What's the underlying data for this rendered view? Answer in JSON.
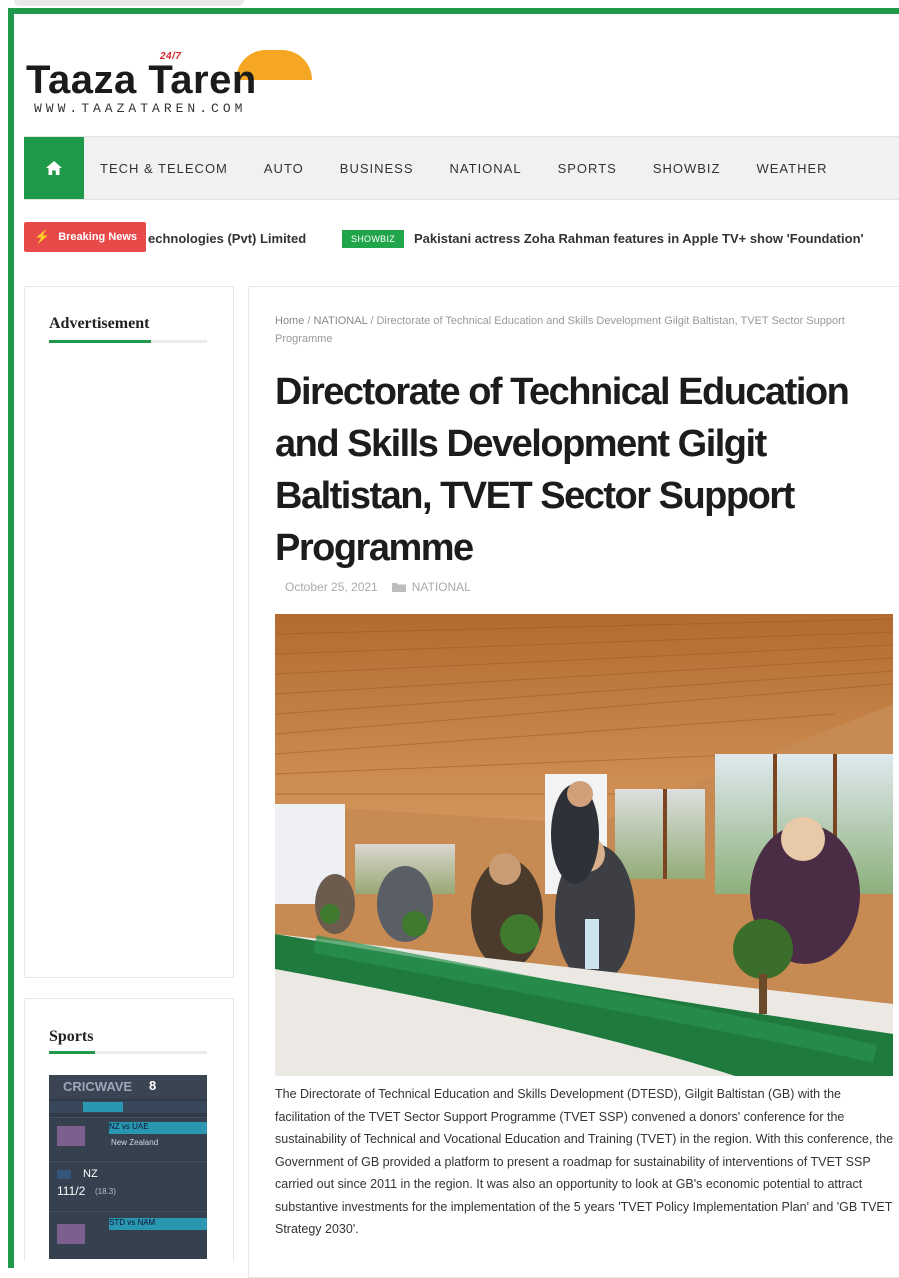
{
  "site": {
    "logo_text": "Taaza Taren",
    "logo_badge": "24/7",
    "logo_url": "WWW.TAAZATAREN.COM"
  },
  "nav": {
    "home_icon": "home-icon",
    "items": [
      "TECH & TELECOM",
      "AUTO",
      "BUSINESS",
      "NATIONAL",
      "SPORTS",
      "SHOWBIZ",
      "WEATHER"
    ]
  },
  "ticker": {
    "label": "Breaking News",
    "item1": "echnologies (Pvt) Limited",
    "badge": "SHOWBIZ",
    "item2": "Pakistani actress Zoha Rahman features in Apple TV+ show 'Foundation'"
  },
  "sidebar": {
    "ad_title": "Advertisement",
    "sports_title": "Sports",
    "sports_widget": {
      "logo": "CRICWAVE",
      "count": "8",
      "team_row": "NZ",
      "score": "111/2",
      "score_overs": "(18.3)",
      "band1": "NZ vs UAE",
      "band2": "New Zealand",
      "band3": "STD vs NAM"
    }
  },
  "article": {
    "breadcrumb_home": "Home",
    "breadcrumb_sep": " / ",
    "breadcrumb_cat": "NATIONAL",
    "breadcrumb_current": "Directorate of Technical Education and Skills Development Gilgit Baltistan, TVET Sector Support Programme",
    "title": "Directorate of Technical Education and Skills Development Gilgit Baltistan, TVET Sector Support Programme",
    "date": "October 25, 2021",
    "category": "NATIONAL",
    "body": "The Directorate of Technical Education and Skills Development (DTESD), Gilgit Baltistan (GB) with the facilitation of the TVET Sector Support Programme (TVET SSP) convened a donors' conference for the sustainability of Technical and Vocational Education and Training (TVET) in the region. With this conference, the Government of GB provided a platform to present a roadmap for sustainability of interventions of TVET SSP carried out since 2011 in the region. It was also an opportunity to look at GB's economic potential to attract substantive investments for the implementation of the 5 years 'TVET Policy Implementation Plan' and 'GB TVET Strategy 2030'."
  },
  "colors": {
    "brand_green": "#1e9a4a",
    "breaking_red": "#e84a4a",
    "logo_orange": "#f5a623"
  }
}
